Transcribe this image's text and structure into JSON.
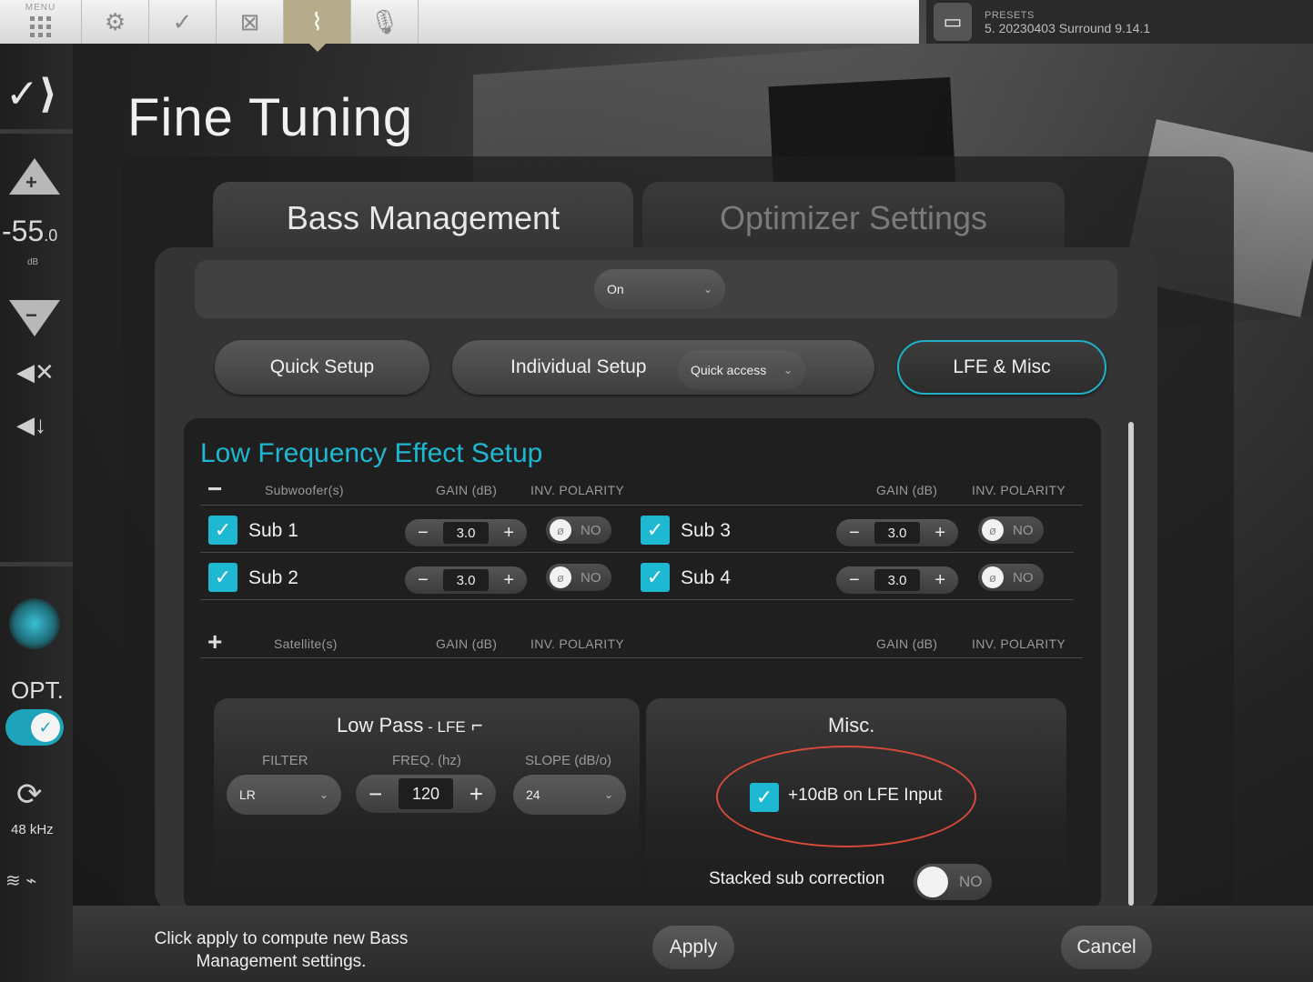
{
  "topbar": {
    "menu_label": "MENU",
    "presets_label": "PRESETS",
    "presets_value": "5. 20230403 Surround 9.14.1"
  },
  "sidebar": {
    "volume_value": "-55",
    "volume_decimal": ".0",
    "volume_unit": "dB",
    "opt_label": "OPT.",
    "sample_rate": "48 kHz"
  },
  "page": {
    "title": "Fine Tuning"
  },
  "tabs": {
    "bass": "Bass Management",
    "optimizer": "Optimizer Settings"
  },
  "mode_dropdown": {
    "value": "On"
  },
  "setup_buttons": {
    "quick": "Quick Setup",
    "individual": "Individual Setup",
    "quick_access": "Quick access",
    "lfe_misc": "LFE & Misc"
  },
  "lfe": {
    "title": "Low Frequency Effect Setup",
    "sub_header": {
      "collapse": "−",
      "label": "Subwoofer(s)",
      "gain": "GAIN (dB)",
      "polarity": "INV. POLARITY",
      "gain2": "GAIN (dB)",
      "polarity2": "INV. POLARITY"
    },
    "subs": [
      {
        "name": "Sub 1",
        "gain": "3.0",
        "polarity": "NO"
      },
      {
        "name": "Sub 3",
        "gain": "3.0",
        "polarity": "NO"
      },
      {
        "name": "Sub 2",
        "gain": "3.0",
        "polarity": "NO"
      },
      {
        "name": "Sub 4",
        "gain": "3.0",
        "polarity": "NO"
      }
    ],
    "sat_header": {
      "expand": "+",
      "label": "Satellite(s)",
      "gain": "GAIN (dB)",
      "polarity": "INV. POLARITY",
      "gain2": "GAIN (dB)",
      "polarity2": "INV. POLARITY"
    }
  },
  "low_pass": {
    "title": "Low Pass",
    "title_suffix": " - LFE",
    "filter_label": "FILTER",
    "filter_value": "LR",
    "freq_label": "FREQ. (hz)",
    "freq_value": "120",
    "slope_label": "SLOPE (dB/o)",
    "slope_value": "24"
  },
  "misc": {
    "title": "Misc.",
    "lfe_boost_label": "+10dB on LFE Input",
    "stacked_label": "Stacked sub correction",
    "stacked_value": "NO"
  },
  "footer": {
    "message": "Click apply to compute new Bass Management settings.",
    "apply": "Apply",
    "cancel": "Cancel"
  },
  "colors": {
    "accent": "#1fb8d2",
    "highlight_ring": "#d84a3a"
  }
}
